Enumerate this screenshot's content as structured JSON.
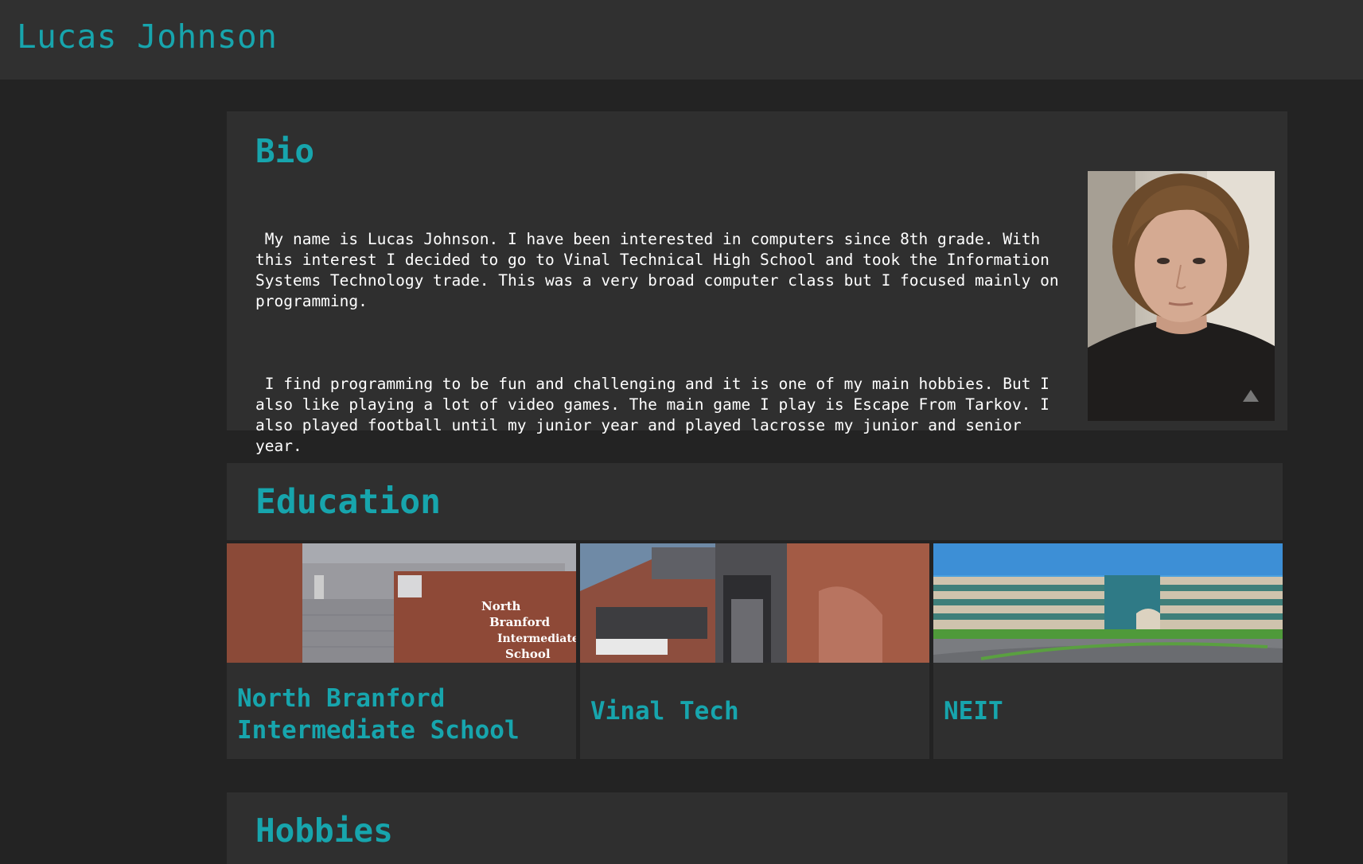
{
  "header": {
    "title": "Lucas Johnson"
  },
  "bio": {
    "heading": "Bio",
    "paragraphs": [
      " My name is Lucas Johnson. I have been interested in computers since 8th grade. With this interest I decided to go to Vinal Technical High School and took the Information Systems Technology trade. This was a very broad computer class but I focused mainly on programming.",
      " I find programming to be fun and challenging and it is one of my main hobbies. But I also like playing a lot of video games. The main game I play is Escape From Tarkov. I also played football until my junior year and played lacrosse my junior and senior year."
    ],
    "photo_alt": "portrait-photo"
  },
  "education": {
    "heading": "Education",
    "schools": [
      {
        "name": "North Branford Intermediate School",
        "sign_lines": [
          "North",
          "Branford",
          "Intermediate",
          "School"
        ]
      },
      {
        "name": "Vinal Tech"
      },
      {
        "name": "NEIT"
      }
    ]
  },
  "hobbies": {
    "heading": "Hobbies"
  },
  "colors": {
    "accent": "#17a5ad",
    "background": "#232323",
    "card": "#2f2f2f",
    "text": "#ffffff"
  }
}
